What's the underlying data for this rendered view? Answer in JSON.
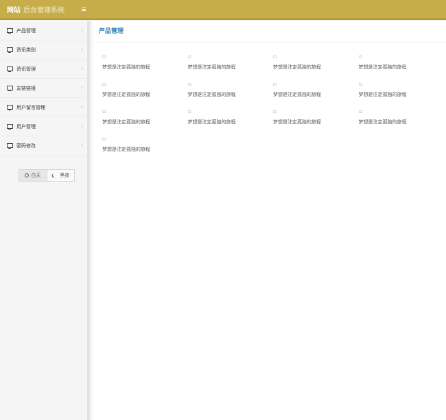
{
  "header": {
    "brand_strong": "网站",
    "brand_sub": "后台管理系统"
  },
  "sidebar": {
    "items": [
      {
        "label": "产品管理"
      },
      {
        "label": "资讯类别"
      },
      {
        "label": "资讯管理"
      },
      {
        "label": "友链链接"
      },
      {
        "label": "用户留言管理"
      },
      {
        "label": "用户管理"
      },
      {
        "label": "密码修改"
      }
    ],
    "chevron": "‹",
    "theme": {
      "day_label": "白天",
      "night_label": "黑夜",
      "selected": "白天"
    }
  },
  "main": {
    "title": "产品管理",
    "products": [
      {
        "title": "梦想是注定孤独的旅程"
      },
      {
        "title": "梦想是注定孤独的旅程"
      },
      {
        "title": "梦想是注定孤独的旅程"
      },
      {
        "title": "梦想是注定孤独的旅程"
      },
      {
        "title": "梦想是注定孤独的旅程"
      },
      {
        "title": "梦想是注定孤独的旅程"
      },
      {
        "title": "梦想是注定孤独的旅程"
      },
      {
        "title": "梦想是注定孤独的旅程"
      },
      {
        "title": "梦想是注定孤独的旅程"
      },
      {
        "title": "梦想是注定孤独的旅程"
      },
      {
        "title": "梦想是注定孤独的旅程"
      },
      {
        "title": "梦想是注定孤独的旅程"
      },
      {
        "title": "梦想是注定孤独的旅程"
      }
    ]
  },
  "colors": {
    "header_bg": "#c6ad4a",
    "title_accent": "#3482b4"
  },
  "icons": {
    "menu": "menu-icon",
    "nav": "monitor-icon",
    "day": "sun-icon",
    "night": "moon-icon",
    "product": "image-placeholder-icon"
  }
}
